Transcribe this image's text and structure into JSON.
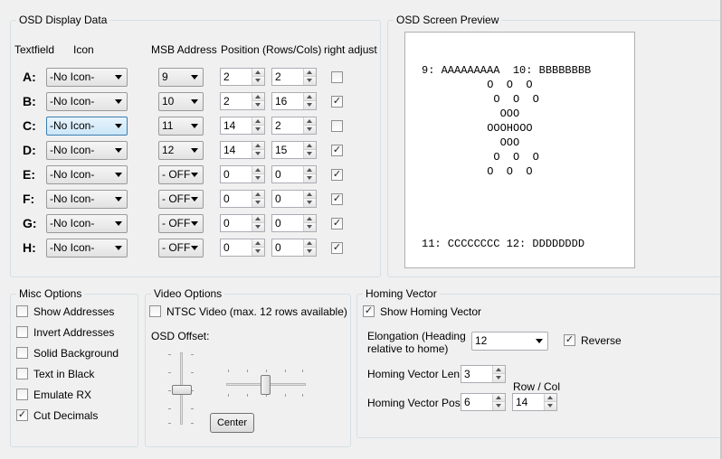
{
  "osd_display": {
    "title": "OSD Display Data",
    "headers": {
      "textfield": "Textfield",
      "icon": "Icon",
      "msb": "MSB Address",
      "position": "Position (Rows/Cols)",
      "right_adjust": "right adjust"
    },
    "rows": [
      {
        "label": "A:",
        "icon": "-No Icon-",
        "msb": "9",
        "row": "2",
        "col": "2",
        "right_adjust": false
      },
      {
        "label": "B:",
        "icon": "-No Icon-",
        "msb": "10",
        "row": "2",
        "col": "16",
        "right_adjust": true
      },
      {
        "label": "C:",
        "icon": "-No Icon-",
        "msb": "11",
        "row": "14",
        "col": "2",
        "right_adjust": false
      },
      {
        "label": "D:",
        "icon": "-No Icon-",
        "msb": "12",
        "row": "14",
        "col": "15",
        "right_adjust": true
      },
      {
        "label": "E:",
        "icon": "-No Icon-",
        "msb": "- OFF",
        "row": "0",
        "col": "0",
        "right_adjust": true
      },
      {
        "label": "F:",
        "icon": "-No Icon-",
        "msb": "- OFF",
        "row": "0",
        "col": "0",
        "right_adjust": true
      },
      {
        "label": "G:",
        "icon": "-No Icon-",
        "msb": "- OFF",
        "row": "0",
        "col": "0",
        "right_adjust": true
      },
      {
        "label": "H:",
        "icon": "-No Icon-",
        "msb": "- OFF",
        "row": "0",
        "col": "0",
        "right_adjust": true
      }
    ]
  },
  "osd_preview": {
    "title": "OSD Screen Preview",
    "lines": [
      "9: AAAAAAAAA  10: BBBBBBBB",
      "      O  O  O",
      "       O  O  O",
      "        OOO",
      "      OOOHOOO",
      "        OOO",
      "       O  O  O",
      "      O  O  O",
      "11: CCCCCCCC 12: DDDDDDDD"
    ]
  },
  "misc_options": {
    "title": "Misc Options",
    "items": [
      {
        "label": "Show Addresses",
        "checked": false
      },
      {
        "label": "Invert Addresses",
        "checked": false
      },
      {
        "label": "Solid Background",
        "checked": false
      },
      {
        "label": "Text in Black",
        "checked": false
      },
      {
        "label": "Emulate RX",
        "checked": false
      },
      {
        "label": "Cut Decimals",
        "checked": true
      }
    ]
  },
  "video_options": {
    "title": "Video Options",
    "ntsc_label": "NTSC Video (max. 12 rows available)",
    "ntsc_checked": false,
    "offset_label": "OSD Offset:",
    "center_button": "Center",
    "vertical_offset_fraction": 0.5,
    "horizontal_offset_fraction": 0.5
  },
  "homing_vector": {
    "title": "Homing Vector",
    "show_label": "Show Homing Vector",
    "show_checked": true,
    "elongation_label": "Elongation (Heading relative to home)",
    "elongation_value": "12",
    "reverse_label": "Reverse",
    "reverse_checked": true,
    "len_label": "Homing Vector Len:",
    "len_value": "3",
    "pos_label": "Homing Vector Pos:",
    "row_col_label": "Row / Col",
    "pos_row": "6",
    "pos_col": "14"
  }
}
